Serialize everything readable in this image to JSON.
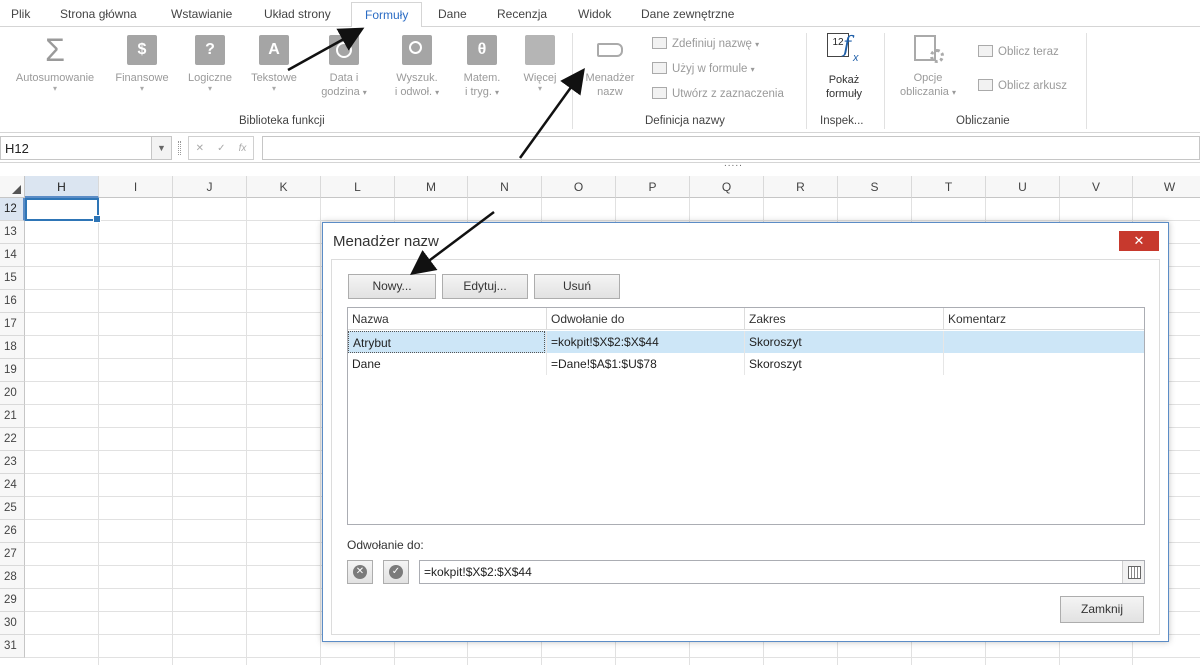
{
  "tabs": [
    {
      "label": "Plik",
      "active": false
    },
    {
      "label": "Strona główna",
      "active": false
    },
    {
      "label": "Wstawianie",
      "active": false
    },
    {
      "label": "Układ strony",
      "active": false
    },
    {
      "label": "Formuły",
      "active": true
    },
    {
      "label": "Dane",
      "active": false
    },
    {
      "label": "Recenzja",
      "active": false
    },
    {
      "label": "Widok",
      "active": false
    },
    {
      "label": "Dane zewnętrzne",
      "active": false
    }
  ],
  "ribbon": {
    "library": {
      "label": "Biblioteka funkcji",
      "buttons": {
        "autosum": {
          "l1": "Autosumowanie",
          "icon": "sigma-icon"
        },
        "financial": {
          "l1": "Finansowe",
          "icon": "dollar-icon"
        },
        "logical": {
          "l1": "Logiczne",
          "icon": "question-icon"
        },
        "text": {
          "l1": "Tekstowe",
          "icon": "text-a-icon"
        },
        "datetime": {
          "l1": "Data i",
          "l2": "godzina",
          "icon": "clock-icon"
        },
        "lookup": {
          "l1": "Wyszuk.",
          "l2": "i odwoł.",
          "icon": "magnifier-icon"
        },
        "math": {
          "l1": "Matem.",
          "l2": "i tryg.",
          "icon": "theta-icon"
        },
        "more": {
          "l1": "Więcej",
          "icon": "more-functions-icon"
        }
      }
    },
    "names": {
      "label": "Definicja nazwy",
      "manager": {
        "l1": "Menadżer",
        "l2": "nazw"
      },
      "define": "Zdefiniuj nazwę",
      "use": "Użyj w formule",
      "create": "Utwórz z zaznaczenia"
    },
    "audit": {
      "label": "Inspek...",
      "show": {
        "l1": "Pokaż",
        "l2": "formuły"
      }
    },
    "calc": {
      "label": "Obliczanie",
      "options": {
        "l1": "Opcje",
        "l2": "obliczania"
      },
      "calc_now": "Oblicz teraz",
      "calc_sheet": "Oblicz arkusz"
    }
  },
  "formula_bar": {
    "name_box": "H12",
    "value": "",
    "more": "....."
  },
  "grid": {
    "columns": [
      "H",
      "I",
      "J",
      "K",
      "L",
      "M",
      "N",
      "O",
      "P",
      "Q",
      "R",
      "S",
      "T",
      "U",
      "V",
      "W"
    ],
    "rows": [
      "12",
      "13",
      "14",
      "15",
      "16",
      "17",
      "18",
      "19",
      "20",
      "21",
      "22",
      "23",
      "24",
      "25",
      "26",
      "27",
      "28",
      "29",
      "30",
      "31"
    ],
    "selected_column": "H",
    "selected_row": "12"
  },
  "dialog": {
    "title": "Menadżer nazw",
    "close": "✕",
    "buttons": {
      "new": "Nowy...",
      "edit": "Edytuj...",
      "delete": "Usuń"
    },
    "columns": [
      "Nazwa",
      "Odwołanie do",
      "Zakres",
      "Komentarz"
    ],
    "rows": [
      {
        "name": "Atrybut",
        "ref": "=kokpit!$X$2:$X$44",
        "scope": "Skoroszyt",
        "comment": "",
        "selected": true
      },
      {
        "name": "Dane",
        "ref": "=Dane!$A$1:$U$78",
        "scope": "Skoroszyt",
        "comment": "",
        "selected": false
      }
    ],
    "ref_label": "Odwołanie do:",
    "ref_value": "=kokpit!$X$2:$X$44",
    "close_button": "Zamknij"
  },
  "colors": {
    "accent": "#2b6cc4",
    "selection": "#cde6f7",
    "close_red": "#c7392d"
  }
}
